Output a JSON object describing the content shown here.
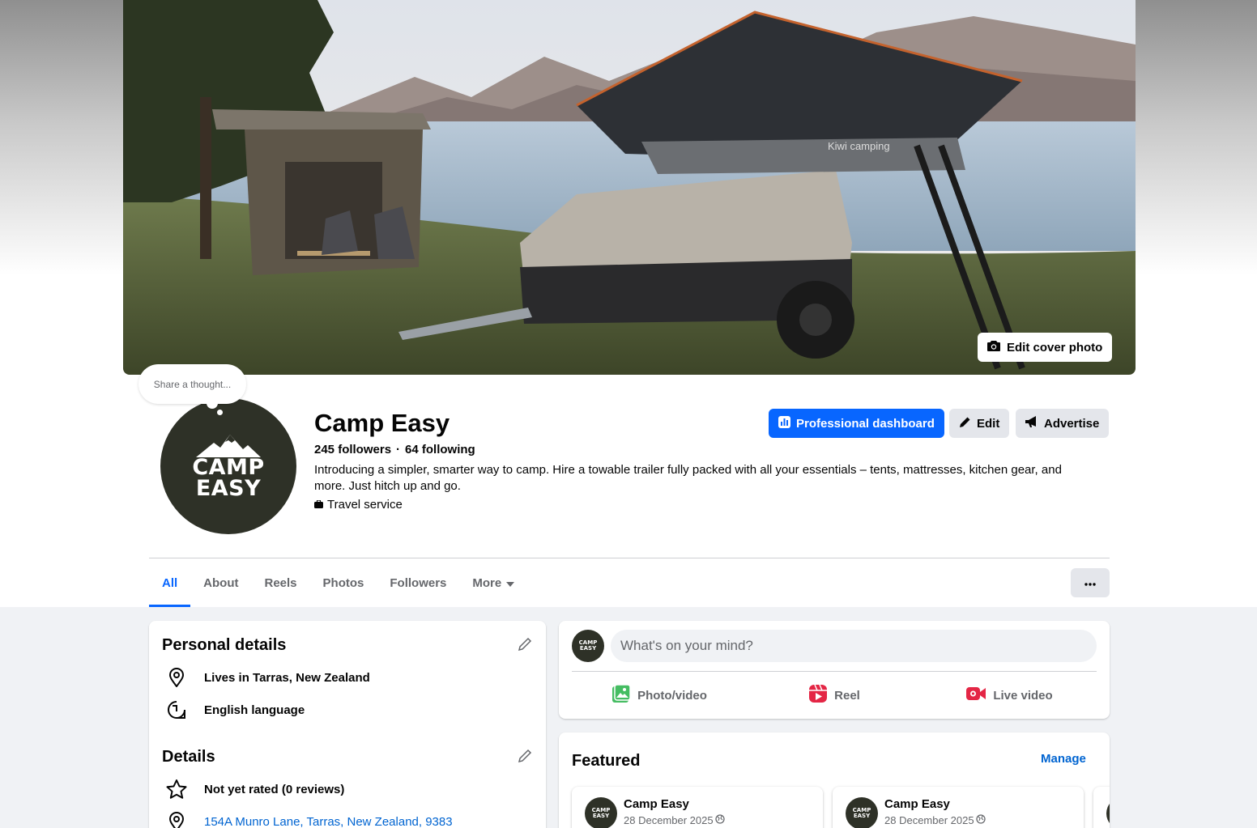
{
  "cover": {
    "edit_label": "Edit cover photo",
    "trailer_brand": "Kiwi camping"
  },
  "thought_bubble": {
    "placeholder": "Share a thought..."
  },
  "profile": {
    "avatar_text": "CAMP EASY",
    "name": "Camp Easy",
    "followers": "245 followers",
    "separator": "·",
    "following": "64 following",
    "bio": "Introducing a simpler, smarter way to camp. Hire a towable trailer fully packed with all your essentials – tents, mattresses, kitchen gear, and more. Just hitch up and go.",
    "category": "Travel service"
  },
  "actions": {
    "dashboard": "Professional dashboard",
    "edit": "Edit",
    "advertise": "Advertise"
  },
  "tabs": [
    {
      "label": "All",
      "active": true
    },
    {
      "label": "About"
    },
    {
      "label": "Reels"
    },
    {
      "label": "Photos"
    },
    {
      "label": "Followers"
    },
    {
      "label": "More"
    }
  ],
  "personal_details": {
    "title": "Personal details",
    "lives": "Lives in Tarras, New Zealand",
    "language": "English language"
  },
  "details": {
    "title": "Details",
    "rating": "Not yet rated (0 reviews)",
    "address": "154A Munro Lane, Tarras, New Zealand, 9383"
  },
  "composer": {
    "placeholder": "What's on your mind?",
    "photo_video": "Photo/video",
    "reel": "Reel",
    "live_video": "Live video"
  },
  "featured": {
    "title": "Featured",
    "manage": "Manage",
    "items": [
      {
        "name": "Camp Easy",
        "date": "28 December 2025"
      },
      {
        "name": "Camp Easy",
        "date": "28 December 2025"
      }
    ]
  },
  "colors": {
    "accent": "#0866ff",
    "link": "#0064d1",
    "avatar_bg": "#2e3127",
    "page_bg": "#f0f2f5"
  }
}
